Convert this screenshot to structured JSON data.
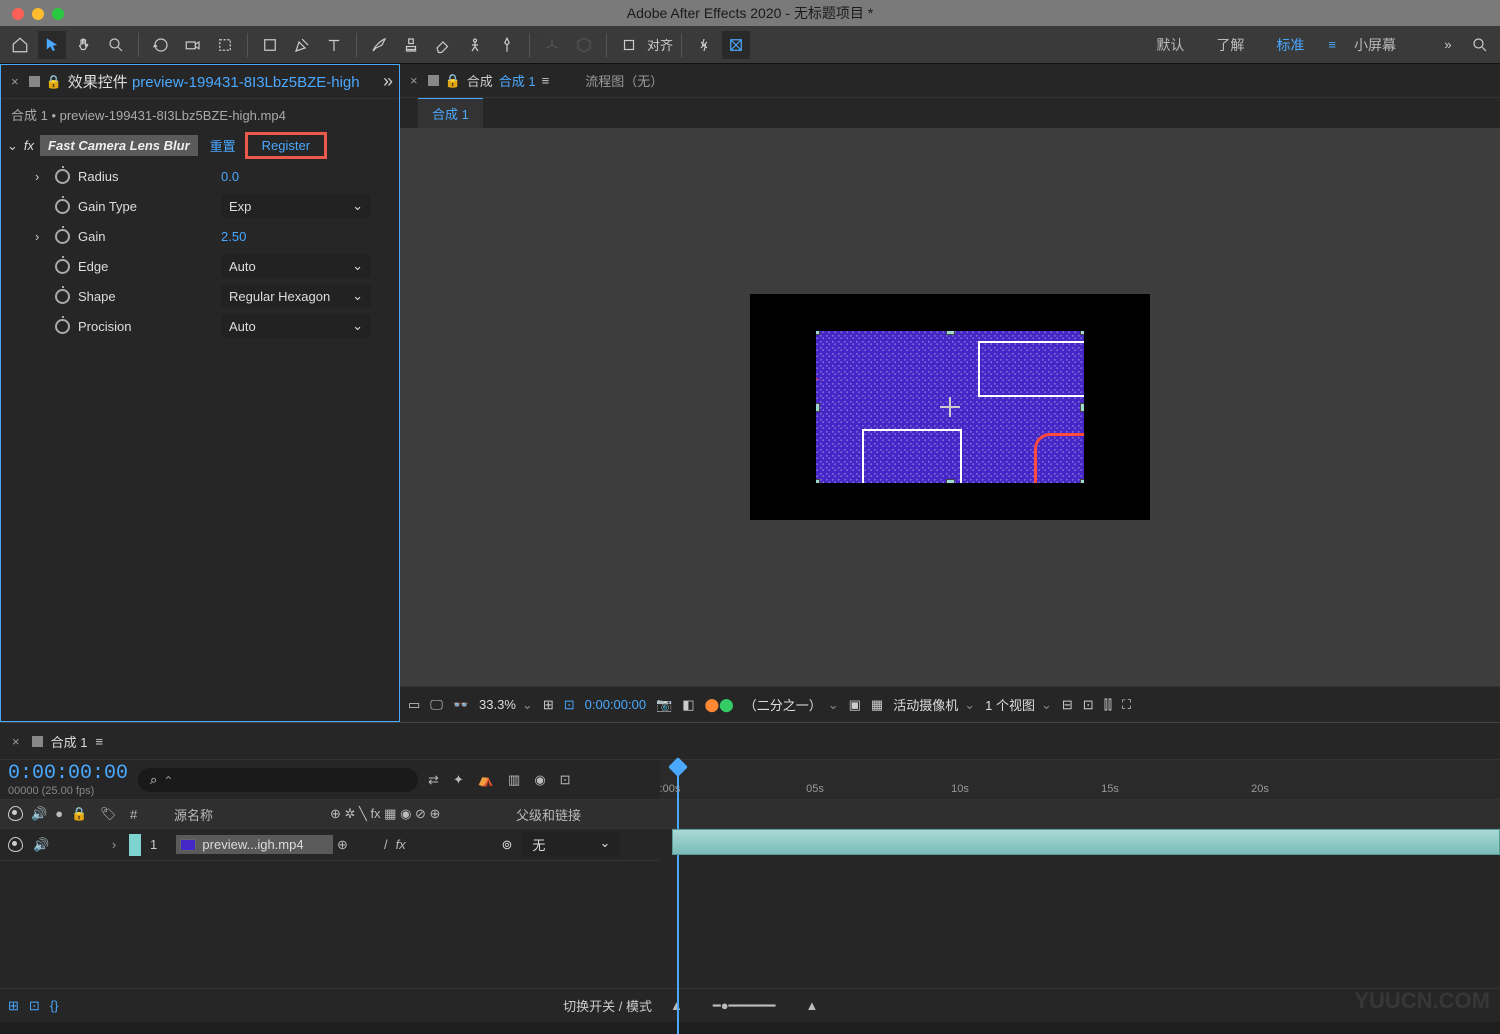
{
  "app_title": "Adobe After Effects 2020 - 无标题项目 *",
  "toolbar": {
    "align_label": "对齐"
  },
  "workspaces": {
    "default": "默认",
    "learn": "了解",
    "standard": "标准",
    "small": "小屏幕"
  },
  "effect_panel": {
    "title_prefix": "效果控件",
    "filename": "preview-199431-8I3Lbz5BZE-high",
    "breadcrumb": "合成 1 • preview-199431-8I3Lbz5BZE-high.mp4",
    "fx_name": "Fast Camera Lens Blur",
    "reset": "重置",
    "register": "Register",
    "props": {
      "radius_label": "Radius",
      "radius_value": "0.0",
      "gaintype_label": "Gain Type",
      "gaintype_value": "Exp",
      "gain_label": "Gain",
      "gain_value": "2.50",
      "edge_label": "Edge",
      "edge_value": "Auto",
      "shape_label": "Shape",
      "shape_value": "Regular Hexagon",
      "precision_label": "Procision",
      "precision_value": "Auto"
    }
  },
  "comp_panel": {
    "comp_label": "合成",
    "comp_name": "合成 1",
    "flowchart": "流程图（无）",
    "mini_tab": "合成 1"
  },
  "viewer_footer": {
    "zoom": "33.3%",
    "timecode": "0:00:00:00",
    "resolution": "（二分之一）",
    "camera": "活动摄像机",
    "views": "1 个视图"
  },
  "timeline": {
    "tab": "合成 1",
    "timecode": "0:00:00:00",
    "fps": "00000 (25.00 fps)",
    "ruler": {
      "t0": ":00s",
      "t1": "05s",
      "t2": "10s",
      "t3": "15s",
      "t4": "20s"
    },
    "cols": {
      "num": "#",
      "source": "源名称",
      "parent": "父级和链接"
    },
    "layer": {
      "num": "1",
      "name": "preview...igh.mp4",
      "parent_value": "无"
    },
    "toggle": "切换开关 / 模式"
  },
  "watermark": "YUUCN.COM"
}
